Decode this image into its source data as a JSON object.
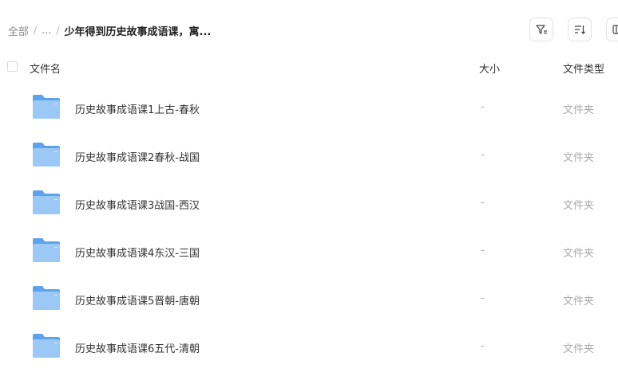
{
  "breadcrumb": {
    "root": "全部",
    "sep1": "/",
    "ellipsis": "...",
    "sep2": "/",
    "current": "少年得到历史故事成语课，寓..."
  },
  "toolbar": {
    "filter_icon": "filter-icon",
    "sort_icon": "sort-icon",
    "view_icon": "view-toggle-icon"
  },
  "table": {
    "headers": {
      "name": "文件名",
      "size": "大小",
      "type": "文件类型"
    },
    "rows": [
      {
        "name": "历史故事成语课1上古-春秋",
        "size": "-",
        "type": "文件夹"
      },
      {
        "name": "历史故事成语课2春秋-战国",
        "size": "-",
        "type": "文件夹"
      },
      {
        "name": "历史故事成语课3战国-西汉",
        "size": "-",
        "type": "文件夹"
      },
      {
        "name": "历史故事成语课4东汉-三国",
        "size": "-",
        "type": "文件夹"
      },
      {
        "name": "历史故事成语课5晋朝-唐朝",
        "size": "-",
        "type": "文件夹"
      },
      {
        "name": "历史故事成语课6五代-清朝",
        "size": "-",
        "type": "文件夹"
      }
    ]
  },
  "colors": {
    "folder_light": "#9cc8f5",
    "folder_dark": "#5da3ec",
    "muted_text": "#aaaaaa"
  }
}
